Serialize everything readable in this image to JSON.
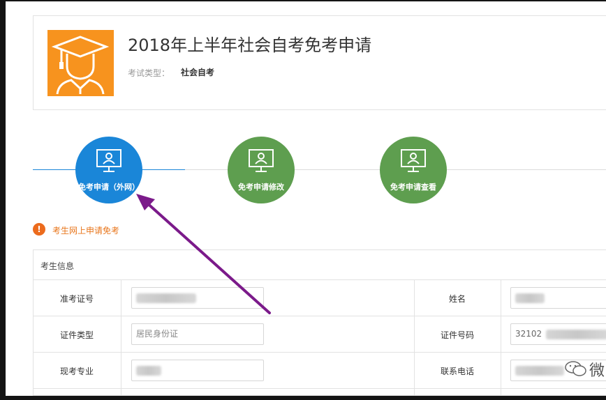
{
  "header": {
    "title": "2018年上半年社会自考免考申请",
    "exam_type_label": "考试类型：",
    "exam_type_value": "社会自考",
    "avatar_icon": "graduate-avatar-icon"
  },
  "steps": [
    {
      "label": "免考申请（外网）",
      "icon": "monitor-user-icon",
      "color": "#1a86d8",
      "active": true
    },
    {
      "label": "免考申请修改",
      "icon": "monitor-user-icon",
      "color": "#5e9e4f",
      "active": false
    },
    {
      "label": "免考申请查看",
      "icon": "monitor-user-icon",
      "color": "#5e9e4f",
      "active": false
    }
  ],
  "notice": {
    "text": "考生网上申请免考",
    "icon": "exclamation-icon",
    "color": "#e8761c"
  },
  "info": {
    "title": "考生信息",
    "rows": [
      {
        "left_label": "准考证号",
        "left_value": "",
        "right_label": "姓名",
        "right_value": ""
      },
      {
        "left_label": "证件类型",
        "left_value": "居民身份证",
        "right_label": "证件号码",
        "right_value": "32102"
      },
      {
        "left_label": "现考专业",
        "left_value": "",
        "right_label": "联系电话",
        "right_value": ""
      }
    ]
  },
  "annotation": {
    "arrow_color": "#7b1a8a"
  },
  "watermark": {
    "icon": "wechat-icon",
    "text": "微"
  }
}
